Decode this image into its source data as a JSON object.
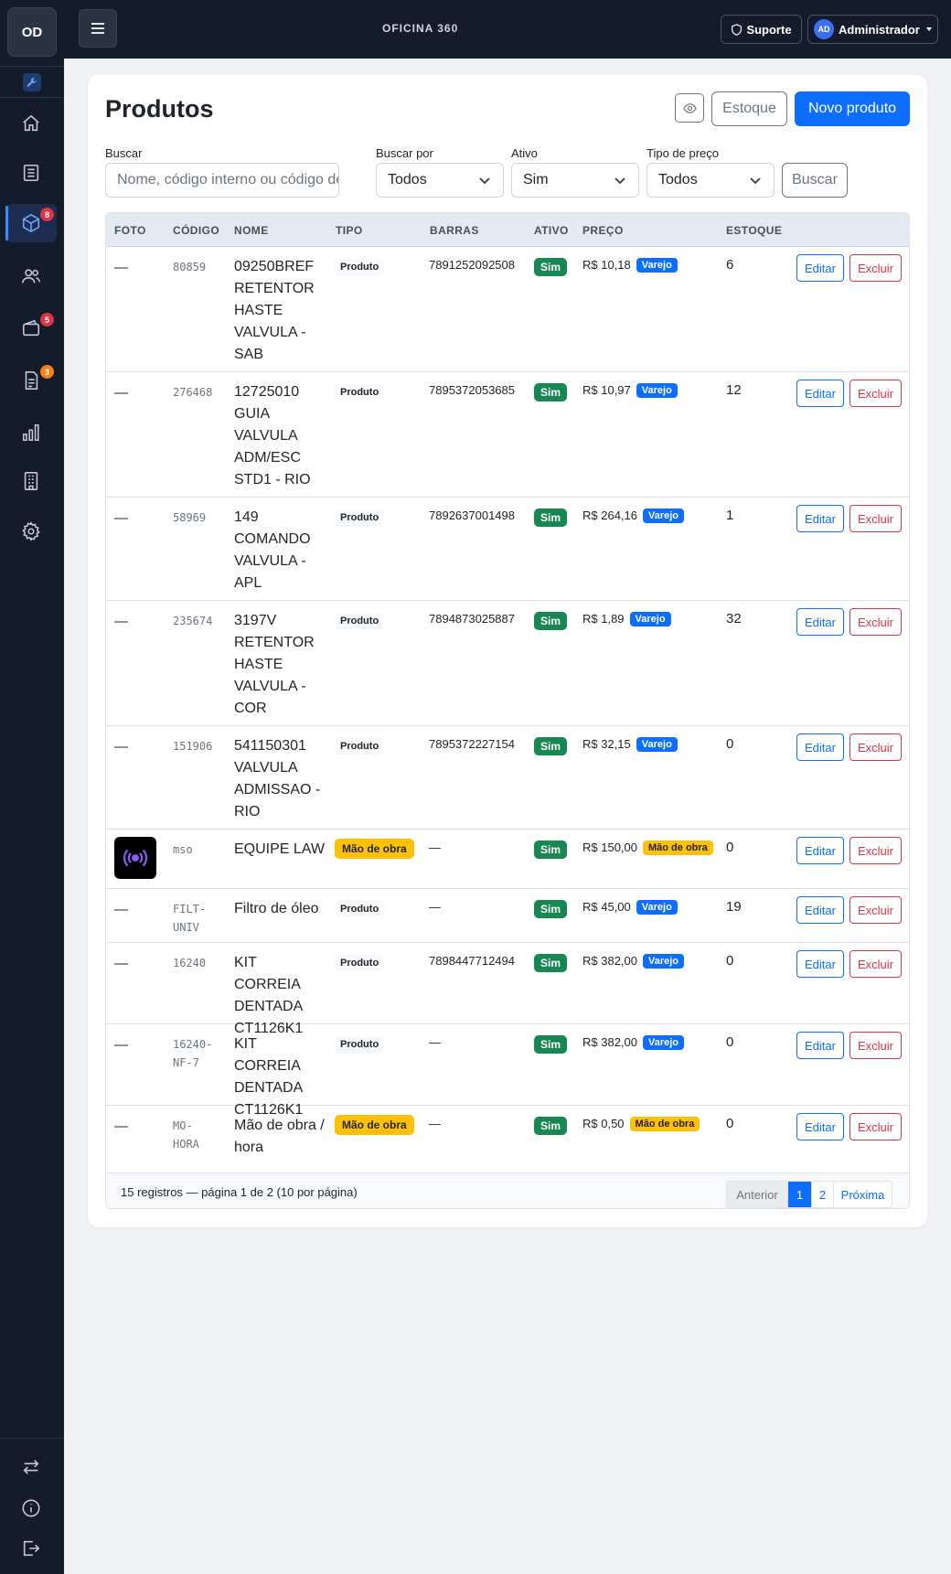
{
  "brand": {
    "initials": "OD"
  },
  "sidebar": {
    "items": [
      {
        "icon": "home-icon"
      },
      {
        "icon": "clipboard-list-icon"
      },
      {
        "icon": "box-icon",
        "badge": "8",
        "active": true
      },
      {
        "icon": "users-icon"
      },
      {
        "icon": "wallet-icon",
        "badge": "5"
      },
      {
        "icon": "document-icon",
        "badge": "3"
      },
      {
        "icon": "bar-chart-icon"
      },
      {
        "icon": "building-icon"
      },
      {
        "icon": "gear-icon"
      }
    ],
    "bottom": [
      {
        "icon": "swap-arrows-icon"
      },
      {
        "icon": "info-icon"
      },
      {
        "icon": "logout-icon"
      }
    ]
  },
  "topbar": {
    "title": "OFICINA 360",
    "support_label": "Suporte",
    "user_initials": "AD",
    "user_label": "Administrador"
  },
  "page": {
    "title": "Produtos",
    "stock_label": "Estoque",
    "new_label": "Novo produto"
  },
  "filters": {
    "search_label": "Buscar",
    "search_placeholder": "Nome, código interno ou código de",
    "search_by_label": "Buscar por",
    "search_by_value": "Todos",
    "active_label": "Ativo",
    "active_value": "Sim",
    "price_type_label": "Tipo de preço",
    "price_type_value": "Todos",
    "search_button": "Buscar"
  },
  "table": {
    "headers": [
      "FOTO",
      "CÓDIGO",
      "NOME",
      "TIPO",
      "BARRAS",
      "ATIVO",
      "PREÇO",
      "ESTOQUE"
    ],
    "edit_label": "Editar",
    "delete_label": "Excluir",
    "rows": [
      {
        "foto": "—",
        "codigo": "80859",
        "nome": "09250BREF RETENTOR HASTE VALVULA - SAB",
        "tipo": "Produto",
        "barras": "7891252092508",
        "ativo": "Sim",
        "preco": "R$ 10,18",
        "preco_tag": "Varejo",
        "estoque": "6"
      },
      {
        "foto": "—",
        "codigo": "276468",
        "nome": "12725010 GUIA VALVULA ADM/ESC STD1 - RIO",
        "tipo": "Produto",
        "barras": "7895372053685",
        "ativo": "Sim",
        "preco": "R$ 10,97",
        "preco_tag": "Varejo",
        "estoque": "12"
      },
      {
        "foto": "—",
        "codigo": "58969",
        "nome": "149 COMANDO VALVULA - APL",
        "tipo": "Produto",
        "barras": "7892637001498",
        "ativo": "Sim",
        "preco": "R$ 264,16",
        "preco_tag": "Varejo",
        "estoque": "1"
      },
      {
        "foto": "—",
        "codigo": "235674",
        "nome": "3197V RETENTOR HASTE VALVULA - COR",
        "tipo": "Produto",
        "barras": "7894873025887",
        "ativo": "Sim",
        "preco": "R$ 1,89",
        "preco_tag": "Varejo",
        "estoque": "32"
      },
      {
        "foto": "—",
        "codigo": "151906",
        "nome": "541150301 VALVULA ADMISSAO - RIO",
        "tipo": "Produto",
        "barras": "7895372227154",
        "ativo": "Sim",
        "preco": "R$ 32,15",
        "preco_tag": "Varejo",
        "estoque": "0"
      },
      {
        "foto": "",
        "codigo": "mso",
        "nome": "EQUIPE LAW",
        "tipo": "Mão de obra",
        "barras": "—",
        "ativo": "Sim",
        "preco": "R$ 150,00",
        "preco_tag": "Mão de obra",
        "estoque": "0"
      },
      {
        "foto": "—",
        "codigo": "FILT-UNIV",
        "nome": "Filtro de óleo",
        "tipo": "Produto",
        "barras": "—",
        "ativo": "Sim",
        "preco": "R$ 45,00",
        "preco_tag": "Varejo",
        "estoque": "19"
      },
      {
        "foto": "—",
        "codigo": "16240",
        "nome": "KIT CORREIA DENTADA CT1126K1",
        "tipo": "Produto",
        "barras": "7898447712494",
        "ativo": "Sim",
        "preco": "R$ 382,00",
        "preco_tag": "Varejo",
        "estoque": "0"
      },
      {
        "foto": "—",
        "codigo": "16240-NF-7",
        "nome": "KIT CORREIA DENTADA CT1126K1",
        "tipo": "Produto",
        "barras": "—",
        "ativo": "Sim",
        "preco": "R$ 382,00",
        "preco_tag": "Varejo",
        "estoque": "0"
      },
      {
        "foto": "—",
        "codigo": "MO-HORA",
        "nome": "Mão de obra / hora",
        "tipo": "Mão de obra",
        "barras": "—",
        "ativo": "Sim",
        "preco": "R$ 0,50",
        "preco_tag": "Mão de obra",
        "estoque": "0"
      }
    ]
  },
  "pagination": {
    "summary": "15 registros — página 1 de 2 (10 por página)",
    "prev": "Anterior",
    "pages": [
      "1",
      "2"
    ],
    "next": "Próxima"
  },
  "colors": {
    "primary": "#0d6efd",
    "danger": "#dc3545",
    "success": "#198754",
    "warning": "#ffc107",
    "sidebar": "#141b2b"
  }
}
